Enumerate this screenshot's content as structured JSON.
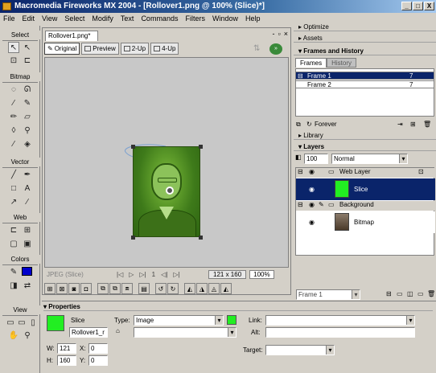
{
  "window": {
    "title": "Macromedia Fireworks MX 2004 - [Rollover1.png @ 100% (Slice)*]",
    "controls": [
      "_",
      "□",
      "X"
    ]
  },
  "menu": [
    "File",
    "Edit",
    "View",
    "Select",
    "Modify",
    "Text",
    "Commands",
    "Filters",
    "Window",
    "Help"
  ],
  "tools": {
    "sections": {
      "select": "Select",
      "bitmap": "Bitmap",
      "vector": "Vector",
      "web": "Web",
      "colors": "Colors",
      "view": "View"
    }
  },
  "document": {
    "tab": "Rollover1.png*",
    "controls": [
      "-",
      "▫",
      "×"
    ],
    "view_tabs": [
      "Original",
      "Preview",
      "2-Up",
      "4-Up"
    ],
    "status": {
      "format": "JPEG (Slice)",
      "frame": "1",
      "size": "121 x 160",
      "zoom": "100%"
    }
  },
  "panels": {
    "optimize": "Optimize",
    "assets": "Assets",
    "frames_history": "Frames and History",
    "tabs": [
      "Frames",
      "History"
    ],
    "frames": [
      {
        "name": "Frame 1",
        "delay": "7"
      },
      {
        "name": "Frame 2",
        "delay": "7"
      }
    ],
    "loop": "Forever",
    "library": "Library",
    "layers": "Layers",
    "opacity": "100",
    "blend": "Normal",
    "layer_items": [
      {
        "name": "Web Layer",
        "type": "folder"
      },
      {
        "name": "Slice",
        "type": "slice"
      },
      {
        "name": "Background",
        "type": "folder"
      },
      {
        "name": "Bitmap",
        "type": "bitmap"
      }
    ],
    "frame_select": "Frame 1"
  },
  "properties": {
    "title": "Properties",
    "object": "Slice",
    "name": "Rollover1_r",
    "w": "121",
    "h": "160",
    "x": "0",
    "y": "0",
    "type_label": "Type:",
    "type_value": "Image",
    "link_label": "Link:",
    "alt_label": "Alt:",
    "target_label": "Target:",
    "w_label": "W:",
    "h_label": "H:",
    "x_label": "X:",
    "y_label": "Y:"
  },
  "colors": {
    "slice": "#22ee22",
    "stroke": "#000000",
    "fill": "#0000cc",
    "title_start": "#0a246a",
    "selection": "#0a246a"
  }
}
